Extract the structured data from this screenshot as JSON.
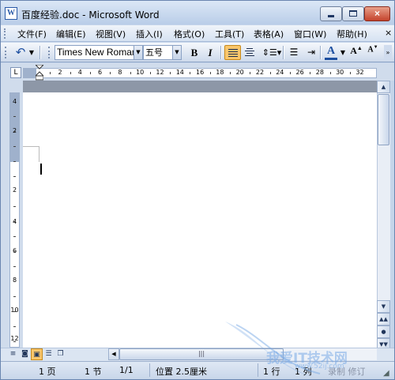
{
  "window": {
    "title": "百度经验.doc - Microsoft Word",
    "icon_letter": "W",
    "controls": {
      "minimize": "minimize-icon",
      "maximize": "maximize-icon",
      "close": "×"
    }
  },
  "menu": {
    "items": [
      "文件(F)",
      "编辑(E)",
      "视图(V)",
      "插入(I)",
      "格式(O)",
      "工具(T)",
      "表格(A)",
      "窗口(W)",
      "帮助(H)"
    ],
    "close_doc": "×"
  },
  "toolbar": {
    "font_name": "Times New Roman",
    "font_size": "五号",
    "bold_label": "B",
    "italic_label": "I",
    "font_color_label": "A",
    "font_color": "#1d4fa0",
    "grow_font_label": "A",
    "shrink_font_label": "A",
    "active_alignment": "justify",
    "icons": [
      "undo-icon",
      "align-justify-icon",
      "align-center-icon",
      "line-spacing-icon",
      "bullets-icon",
      "indent-icon"
    ]
  },
  "ruler": {
    "horizontal_labels": [
      "2",
      "4",
      "6",
      "8",
      "10",
      "12",
      "14",
      "16",
      "18",
      "20",
      "22",
      "24",
      "26",
      "28",
      "30",
      "32"
    ],
    "vertical_labels": [
      "4",
      "2",
      "2",
      "4",
      "6",
      "8",
      "10",
      "12"
    ],
    "tab_selector": "L"
  },
  "scroll": {
    "h_thumb_label": "|||"
  },
  "status": {
    "page": "1 页",
    "section": "1 节",
    "page_of": "1/1",
    "position": "位置 2.5厘米",
    "line": "1 行",
    "column": "1 列",
    "modes": "录制  修订"
  },
  "watermark": {
    "text": "我爱IT技术网",
    "sub": "www.52ij.com"
  },
  "colors": {
    "accent_active": "#f9c66b",
    "chrome": "#c5d5ea",
    "page_band": "#8d97a7"
  }
}
